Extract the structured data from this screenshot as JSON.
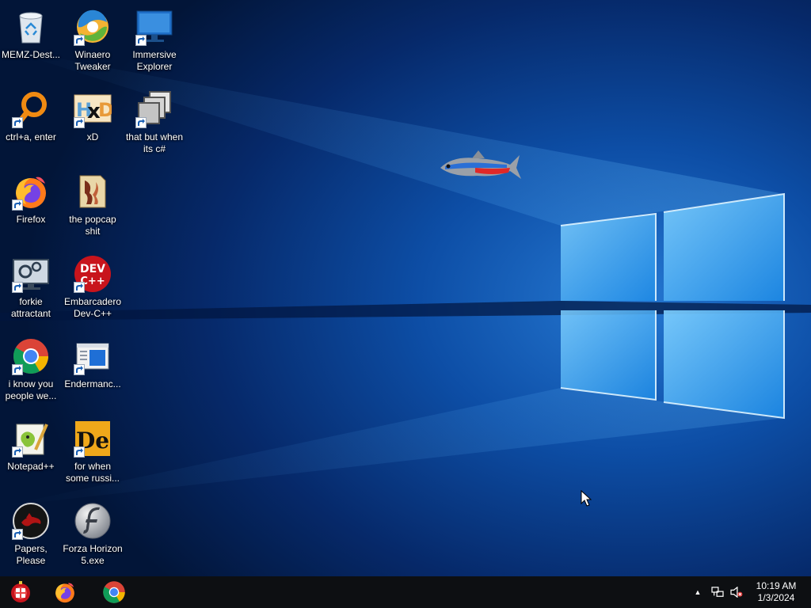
{
  "desktop": {
    "icons": [
      {
        "label": "MEMZ-Dest...",
        "icon": "recycle-bin-icon"
      },
      {
        "label": "Winaero\nTweaker",
        "icon": "winaero-tweaker-icon"
      },
      {
        "label": "Immersive\nExplorer",
        "icon": "monitor-icon"
      },
      {
        "label": "ctrl+a, enter",
        "icon": "magnifier-icon"
      },
      {
        "label": "xD",
        "icon": "hxd-icon"
      },
      {
        "label": "that but when\nits c#",
        "icon": "windows-stack-icon"
      },
      {
        "label": "Firefox",
        "icon": "firefox-icon"
      },
      {
        "label": "the popcap\nshit",
        "icon": "popcap-folder-icon"
      },
      {
        "label": "forkie\nattractant",
        "icon": "settings-monitor-icon"
      },
      {
        "label": "Embarcadero\nDev-C++",
        "icon": "dev-cpp-icon"
      },
      {
        "label": "i know you\npeople we...",
        "icon": "chrome-icon"
      },
      {
        "label": "Endermanc...",
        "icon": "window-app-icon"
      },
      {
        "label": "Notepad++",
        "icon": "notepadpp-icon"
      },
      {
        "label": "for when\nsome russi...",
        "icon": "dependency-walker-icon"
      },
      {
        "label": "Papers, Please",
        "icon": "papers-please-icon"
      },
      {
        "label": "Forza Horizon\n5.exe",
        "icon": "flash-icon"
      }
    ],
    "logo_text": {
      "dev": "DEV",
      "cpp": "C++",
      "de": "De"
    }
  },
  "taskbar": {
    "pinned": [
      "start-orb-icon",
      "firefox-icon",
      "chrome-icon"
    ],
    "tray": {
      "overflow": "▲",
      "network": "network-icon",
      "volume": "volume-muted-icon"
    },
    "clock": {
      "time": "10:19 AM",
      "date": "1/3/2024"
    }
  },
  "colors": {
    "wallpaper_dark": "#03163b",
    "wallpaper_accent": "#2a9cf0",
    "taskbar": "#0d0f12"
  }
}
